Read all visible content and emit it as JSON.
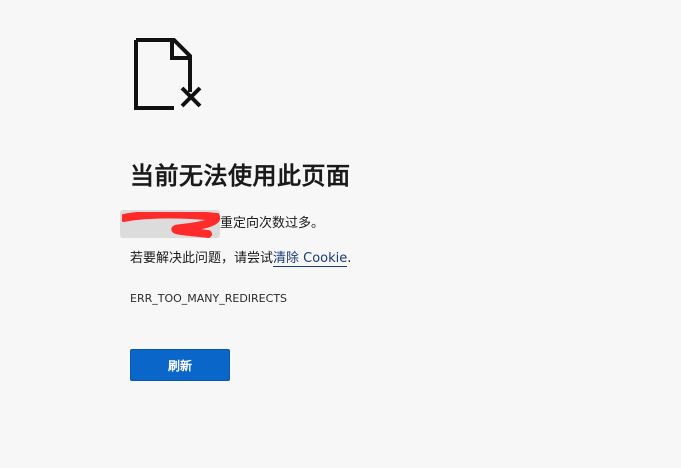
{
  "error_page": {
    "icon": "page-error-icon",
    "heading": "当前无法使用此页面",
    "redirect_message": "重定向次数过多。",
    "suggestion_prefix": "若要解决此问题，请尝试",
    "suggestion_link": "清除 Cookie",
    "suggestion_suffix": ".",
    "error_code": "ERR_TOO_MANY_REDIRECTS",
    "refresh_label": "刷新"
  },
  "colors": {
    "background": "#f7f7f7",
    "button": "#0a66c8",
    "link": "#1b3a7a",
    "redaction": "#ff2b2b"
  }
}
